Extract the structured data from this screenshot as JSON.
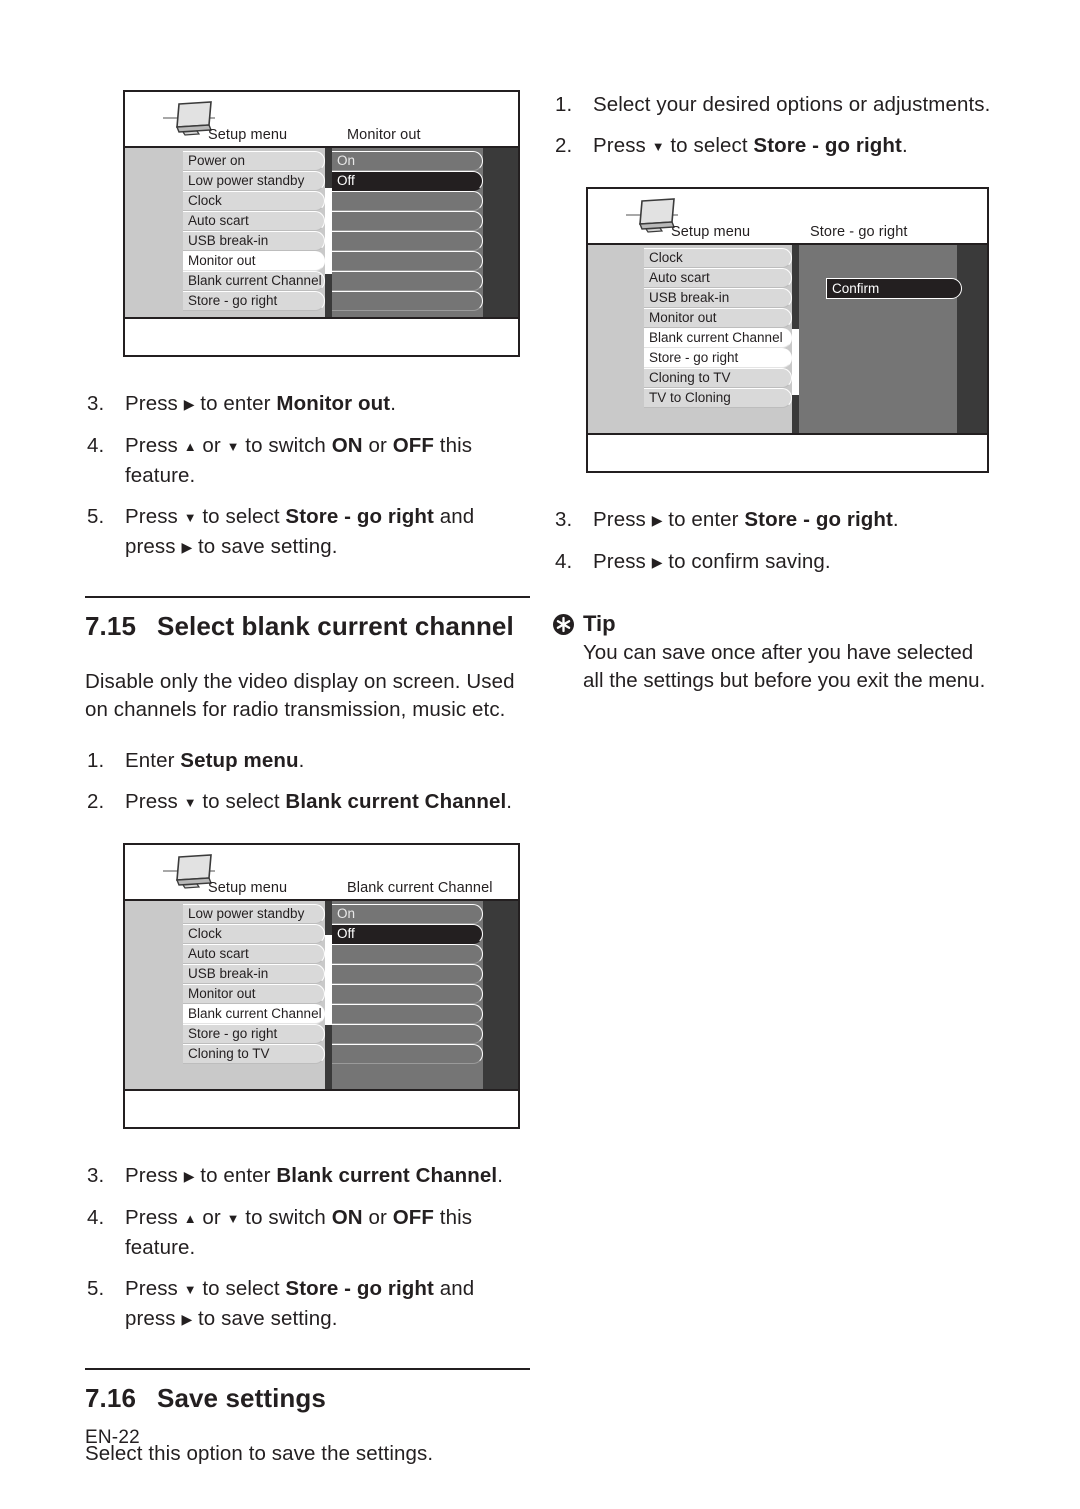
{
  "page": {
    "footer_label": "EN-22"
  },
  "left_column": {
    "figure_monitor_out": {
      "name": "monitor-out-menu-figure",
      "title_left": "Setup menu",
      "title_right": "Monitor out",
      "menu_items": [
        {
          "label": "Power on",
          "selected": false
        },
        {
          "label": "Low power standby",
          "selected": false
        },
        {
          "label": "Clock",
          "selected": false
        },
        {
          "label": "Auto scart",
          "selected": false
        },
        {
          "label": "USB break-in",
          "selected": false
        },
        {
          "label": "Monitor out",
          "selected": true
        },
        {
          "label": "Blank current Channel",
          "selected": false
        },
        {
          "label": "Store - go right",
          "selected": false
        }
      ],
      "options": [
        {
          "label": "On",
          "highlighted": false
        },
        {
          "label": "Off",
          "highlighted": true
        },
        {
          "label": "",
          "highlighted": false
        },
        {
          "label": "",
          "highlighted": false
        },
        {
          "label": "",
          "highlighted": false
        },
        {
          "label": "",
          "highlighted": false
        },
        {
          "label": "",
          "highlighted": false
        },
        {
          "label": "",
          "highlighted": false
        }
      ]
    },
    "steps_monitor_out": [
      {
        "num": "3.",
        "parts": [
          {
            "t": "Press "
          },
          {
            "t": "▶",
            "style": "arrow-r"
          },
          {
            "t": " to enter "
          },
          {
            "t": "Monitor out",
            "style": "b"
          },
          {
            "t": "."
          }
        ]
      },
      {
        "num": "4.",
        "parts": [
          {
            "t": "Press "
          },
          {
            "t": "▲",
            "style": "arrow-u"
          },
          {
            "t": " or "
          },
          {
            "t": "▼",
            "style": "arrow-d"
          },
          {
            "t": " to switch "
          },
          {
            "t": "ON",
            "style": "b"
          },
          {
            "t": " or "
          },
          {
            "t": "OFF",
            "style": "b"
          },
          {
            "t": " this feature."
          }
        ]
      },
      {
        "num": "5.",
        "parts": [
          {
            "t": "Press "
          },
          {
            "t": "▼",
            "style": "arrow-d"
          },
          {
            "t": " to select "
          },
          {
            "t": "Store - go right",
            "style": "b"
          },
          {
            "t": " and press "
          },
          {
            "t": "▶",
            "style": "arrow-r"
          },
          {
            "t": " to save setting."
          }
        ]
      }
    ],
    "section_715": {
      "number": "7.15",
      "title": "Select blank current channel",
      "intro": "Disable only the video display on screen. Used on channels for radio transmission, music etc.",
      "steps": [
        {
          "num": "1.",
          "parts": [
            {
              "t": "Enter "
            },
            {
              "t": "Setup menu",
              "style": "b"
            },
            {
              "t": "."
            }
          ]
        },
        {
          "num": "2.",
          "parts": [
            {
              "t": "Press "
            },
            {
              "t": "▼",
              "style": "arrow-d"
            },
            {
              "t": " to select "
            },
            {
              "t": "Blank current Channel",
              "style": "b"
            },
            {
              "t": "."
            }
          ]
        }
      ]
    },
    "figure_blank_channel": {
      "name": "blank-current-channel-menu-figure",
      "title_left": "Setup menu",
      "title_right": "Blank current Channel",
      "menu_items": [
        {
          "label": "Low power standby",
          "selected": false
        },
        {
          "label": "Clock",
          "selected": false
        },
        {
          "label": "Auto scart",
          "selected": false
        },
        {
          "label": "USB break-in",
          "selected": false
        },
        {
          "label": "Monitor out",
          "selected": false
        },
        {
          "label": "Blank current Channel",
          "selected": true
        },
        {
          "label": "Store - go right",
          "selected": false
        },
        {
          "label": "Cloning to TV",
          "selected": false
        }
      ],
      "options": [
        {
          "label": "On",
          "highlighted": false
        },
        {
          "label": "Off",
          "highlighted": true
        },
        {
          "label": "",
          "highlighted": false
        },
        {
          "label": "",
          "highlighted": false
        },
        {
          "label": "",
          "highlighted": false
        },
        {
          "label": "",
          "highlighted": false
        },
        {
          "label": "",
          "highlighted": false
        },
        {
          "label": "",
          "highlighted": false
        }
      ]
    },
    "steps_blank_channel": [
      {
        "num": "3.",
        "parts": [
          {
            "t": "Press "
          },
          {
            "t": "▶",
            "style": "arrow-r"
          },
          {
            "t": " to enter "
          },
          {
            "t": "Blank current Channel",
            "style": "b"
          },
          {
            "t": "."
          }
        ]
      },
      {
        "num": "4.",
        "parts": [
          {
            "t": "Press "
          },
          {
            "t": "▲",
            "style": "arrow-u"
          },
          {
            "t": " or "
          },
          {
            "t": "▼",
            "style": "arrow-d"
          },
          {
            "t": " to switch "
          },
          {
            "t": "ON",
            "style": "b"
          },
          {
            "t": " or "
          },
          {
            "t": "OFF",
            "style": "b"
          },
          {
            "t": " this feature."
          }
        ]
      },
      {
        "num": "5.",
        "parts": [
          {
            "t": "Press "
          },
          {
            "t": "▼",
            "style": "arrow-d"
          },
          {
            "t": " to select "
          },
          {
            "t": "Store - go right",
            "style": "b"
          },
          {
            "t": " and press "
          },
          {
            "t": "▶",
            "style": "arrow-r"
          },
          {
            "t": " to save setting."
          }
        ]
      }
    ],
    "section_716": {
      "number": "7.16",
      "title": "Save settings",
      "intro": "Select this option to save the settings."
    }
  },
  "right_column": {
    "steps_top": [
      {
        "num": "1.",
        "parts": [
          {
            "t": "Select your desired options or adjustments."
          }
        ]
      },
      {
        "num": "2.",
        "parts": [
          {
            "t": "Press "
          },
          {
            "t": "▼",
            "style": "arrow-d"
          },
          {
            "t": " to select "
          },
          {
            "t": "Store - go right",
            "style": "b"
          },
          {
            "t": "."
          }
        ]
      }
    ],
    "figure_store_go_right": {
      "name": "store-go-right-menu-figure",
      "title_left": "Setup menu",
      "title_right": "Store - go right",
      "menu_items": [
        {
          "label": "Clock",
          "selected": false
        },
        {
          "label": "Auto scart",
          "selected": false
        },
        {
          "label": "USB break-in",
          "selected": false
        },
        {
          "label": "Monitor out",
          "selected": false
        },
        {
          "label": "Blank current Channel",
          "selected": true
        },
        {
          "label": "Store - go right",
          "selected": true
        },
        {
          "label": "Cloning to TV",
          "selected": false
        },
        {
          "label": "TV to Cloning",
          "selected": false
        }
      ],
      "confirm_label": "Confirm"
    },
    "steps_bottom": [
      {
        "num": "3.",
        "parts": [
          {
            "t": "Press "
          },
          {
            "t": "▶",
            "style": "arrow-r"
          },
          {
            "t": " to enter "
          },
          {
            "t": "Store - go right",
            "style": "b"
          },
          {
            "t": "."
          }
        ]
      },
      {
        "num": "4.",
        "parts": [
          {
            "t": "Press "
          },
          {
            "t": "▶",
            "style": "arrow-r"
          },
          {
            "t": " to confirm saving."
          }
        ]
      }
    ],
    "tip": {
      "heading": "Tip",
      "body": "You can save once after you have selected all the settings but before you exit the menu."
    }
  }
}
